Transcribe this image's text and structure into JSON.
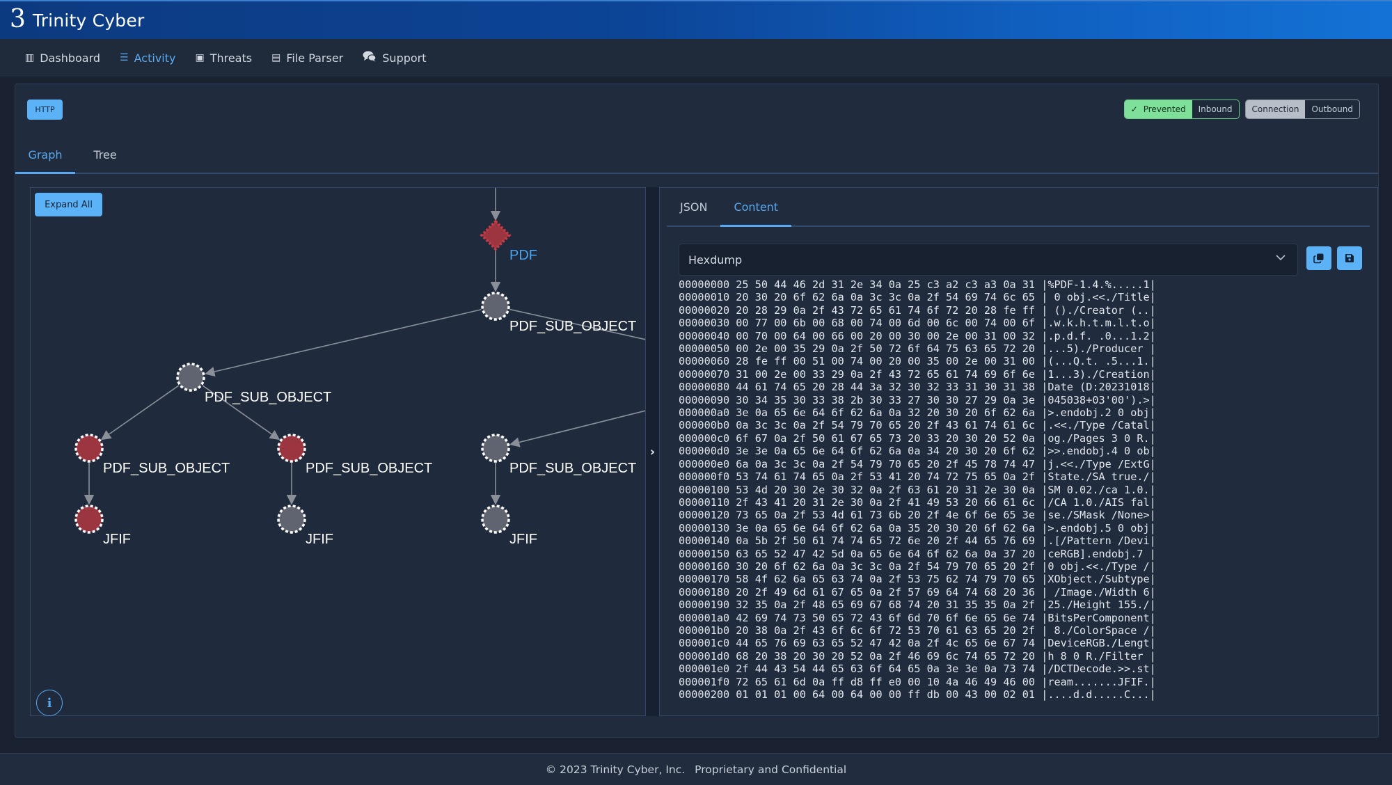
{
  "header": {
    "logo_glyph": "3",
    "brand": "Trinity Cyber"
  },
  "nav": {
    "items": [
      {
        "label": "Dashboard",
        "icon": "chart-bar-icon",
        "glyph": "▥",
        "active": false
      },
      {
        "label": "Activity",
        "icon": "list-icon",
        "glyph": "☰",
        "active": true
      },
      {
        "label": "Threats",
        "icon": "id-badge-icon",
        "glyph": "▣",
        "active": false
      },
      {
        "label": "File Parser",
        "icon": "file-code-icon",
        "glyph": "▤",
        "active": false
      },
      {
        "label": "Support",
        "icon": "comments-icon",
        "glyph": "💬",
        "active": false
      }
    ]
  },
  "event": {
    "protocol_badge": "HTTP",
    "status": {
      "prevented": "Prevented",
      "direction": "Inbound",
      "type": "Connection",
      "flow": "Outbound"
    }
  },
  "view_tabs": [
    {
      "label": "Graph",
      "active": true
    },
    {
      "label": "Tree",
      "active": false
    }
  ],
  "graph": {
    "expand_all_label": "Expand All",
    "colors": {
      "alert": "#9b3540",
      "neutral": "#5f6470",
      "root": "#c83a44",
      "edge": "#8a8f98",
      "root_label": "#4aa3ec"
    },
    "nodes": [
      {
        "id": "n0",
        "label": "PDF",
        "shape": "diamond",
        "status": "alert"
      },
      {
        "id": "n1",
        "label": "PDF_SUB_OBJECT",
        "shape": "circle",
        "status": "neutral"
      },
      {
        "id": "n2",
        "label": "PDF_SUB_OBJECT",
        "shape": "circle",
        "status": "neutral"
      },
      {
        "id": "n3",
        "label": "PDF_SUB_OBJECT",
        "shape": "circle",
        "status": "alert"
      },
      {
        "id": "n4",
        "label": "PDF_SUB_OBJECT",
        "shape": "circle",
        "status": "alert"
      },
      {
        "id": "n5",
        "label": "PDF_SUB_OBJECT",
        "shape": "circle",
        "status": "neutral"
      },
      {
        "id": "n6",
        "label": "JFIF",
        "shape": "circle",
        "status": "alert"
      },
      {
        "id": "n7",
        "label": "JFIF",
        "shape": "circle",
        "status": "neutral"
      },
      {
        "id": "n8",
        "label": "JFIF",
        "shape": "circle",
        "status": "neutral"
      }
    ],
    "edges": [
      [
        "in",
        "n0"
      ],
      [
        "n0",
        "n1"
      ],
      [
        "n1",
        "n2"
      ],
      [
        "n1",
        "off"
      ],
      [
        "off2",
        "n5"
      ],
      [
        "n2",
        "n3"
      ],
      [
        "n2",
        "n4"
      ],
      [
        "n3",
        "n6"
      ],
      [
        "n4",
        "n7"
      ],
      [
        "n5",
        "n8"
      ]
    ],
    "info_label": "i",
    "collapse_glyph": "›"
  },
  "detail": {
    "tabs": [
      {
        "label": "JSON",
        "active": false
      },
      {
        "label": "Content",
        "active": true
      }
    ],
    "format": {
      "selected": "Hexdump"
    },
    "copy_label": "copy-icon",
    "save_label": "save-icon",
    "hexdump": [
      "00000000 25 50 44 46 2d 31 2e 34 0a 25 c3 a2 c3 a3 0a 31 |%PDF-1.4.%.....1|",
      "00000010 20 30 20 6f 62 6a 0a 3c 3c 0a 2f 54 69 74 6c 65 | 0 obj.<<./Title|",
      "00000020 20 28 29 0a 2f 43 72 65 61 74 6f 72 20 28 fe ff | ()./Creator (..|",
      "00000030 00 77 00 6b 00 68 00 74 00 6d 00 6c 00 74 00 6f |.w.k.h.t.m.l.t.o|",
      "00000040 00 70 00 64 00 66 00 20 00 30 00 2e 00 31 00 32 |.p.d.f. .0...1.2|",
      "00000050 00 2e 00 35 29 0a 2f 50 72 6f 64 75 63 65 72 20 |...5)./Producer |",
      "00000060 28 fe ff 00 51 00 74 00 20 00 35 00 2e 00 31 00 |(...Q.t. .5...1.|",
      "00000070 31 00 2e 00 33 29 0a 2f 43 72 65 61 74 69 6f 6e |1...3)./Creation|",
      "00000080 44 61 74 65 20 28 44 3a 32 30 32 33 31 30 31 38 |Date (D:20231018|",
      "00000090 30 34 35 30 33 38 2b 30 33 27 30 30 27 29 0a 3e |045038+03'00').>|",
      "000000a0 3e 0a 65 6e 64 6f 62 6a 0a 32 20 30 20 6f 62 6a |>.endobj.2 0 obj|",
      "000000b0 0a 3c 3c 0a 2f 54 79 70 65 20 2f 43 61 74 61 6c |.<<./Type /Catal|",
      "000000c0 6f 67 0a 2f 50 61 67 65 73 20 33 20 30 20 52 0a |og./Pages 3 0 R.|",
      "000000d0 3e 3e 0a 65 6e 64 6f 62 6a 0a 34 20 30 20 6f 62 |>>.endobj.4 0 ob|",
      "000000e0 6a 0a 3c 3c 0a 2f 54 79 70 65 20 2f 45 78 74 47 |j.<<./Type /ExtG|",
      "000000f0 53 74 61 74 65 0a 2f 53 41 20 74 72 75 65 0a 2f |State./SA true./|",
      "00000100 53 4d 20 30 2e 30 32 0a 2f 63 61 20 31 2e 30 0a |SM 0.02./ca 1.0.|",
      "00000110 2f 43 41 20 31 2e 30 0a 2f 41 49 53 20 66 61 6c |/CA 1.0./AIS fal|",
      "00000120 73 65 0a 2f 53 4d 61 73 6b 20 2f 4e 6f 6e 65 3e |se./SMask /None>|",
      "00000130 3e 0a 65 6e 64 6f 62 6a 0a 35 20 30 20 6f 62 6a |>.endobj.5 0 obj|",
      "00000140 0a 5b 2f 50 61 74 74 65 72 6e 20 2f 44 65 76 69 |.[/Pattern /Devi|",
      "00000150 63 65 52 47 42 5d 0a 65 6e 64 6f 62 6a 0a 37 20 |ceRGB].endobj.7 |",
      "00000160 30 20 6f 62 6a 0a 3c 3c 0a 2f 54 79 70 65 20 2f |0 obj.<<./Type /|",
      "00000170 58 4f 62 6a 65 63 74 0a 2f 53 75 62 74 79 70 65 |XObject./Subtype|",
      "00000180 20 2f 49 6d 61 67 65 0a 2f 57 69 64 74 68 20 36 | /Image./Width 6|",
      "00000190 32 35 0a 2f 48 65 69 67 68 74 20 31 35 35 0a 2f |25./Height 155./|",
      "000001a0 42 69 74 73 50 65 72 43 6f 6d 70 6f 6e 65 6e 74 |BitsPerComponent|",
      "000001b0 20 38 0a 2f 43 6f 6c 6f 72 53 70 61 63 65 20 2f | 8./ColorSpace /|",
      "000001c0 44 65 76 69 63 65 52 47 42 0a 2f 4c 65 6e 67 74 |DeviceRGB./Lengt|",
      "000001d0 68 20 38 20 30 20 52 0a 2f 46 69 6c 74 65 72 20 |h 8 0 R./Filter |",
      "000001e0 2f 44 43 54 44 65 63 6f 64 65 0a 3e 3e 0a 73 74 |/DCTDecode.>>.st|",
      "000001f0 72 65 61 6d 0a ff d8 ff e0 00 10 4a 46 49 46 00 |ream.......JFIF.|",
      "00000200 01 01 01 00 64 00 64 00 00 ff db 00 43 00 02 01 |....d.d.....C...|"
    ]
  },
  "footer": {
    "copyright": "© 2023 Trinity Cyber, Inc.",
    "notice": "Proprietary and Confidential"
  }
}
